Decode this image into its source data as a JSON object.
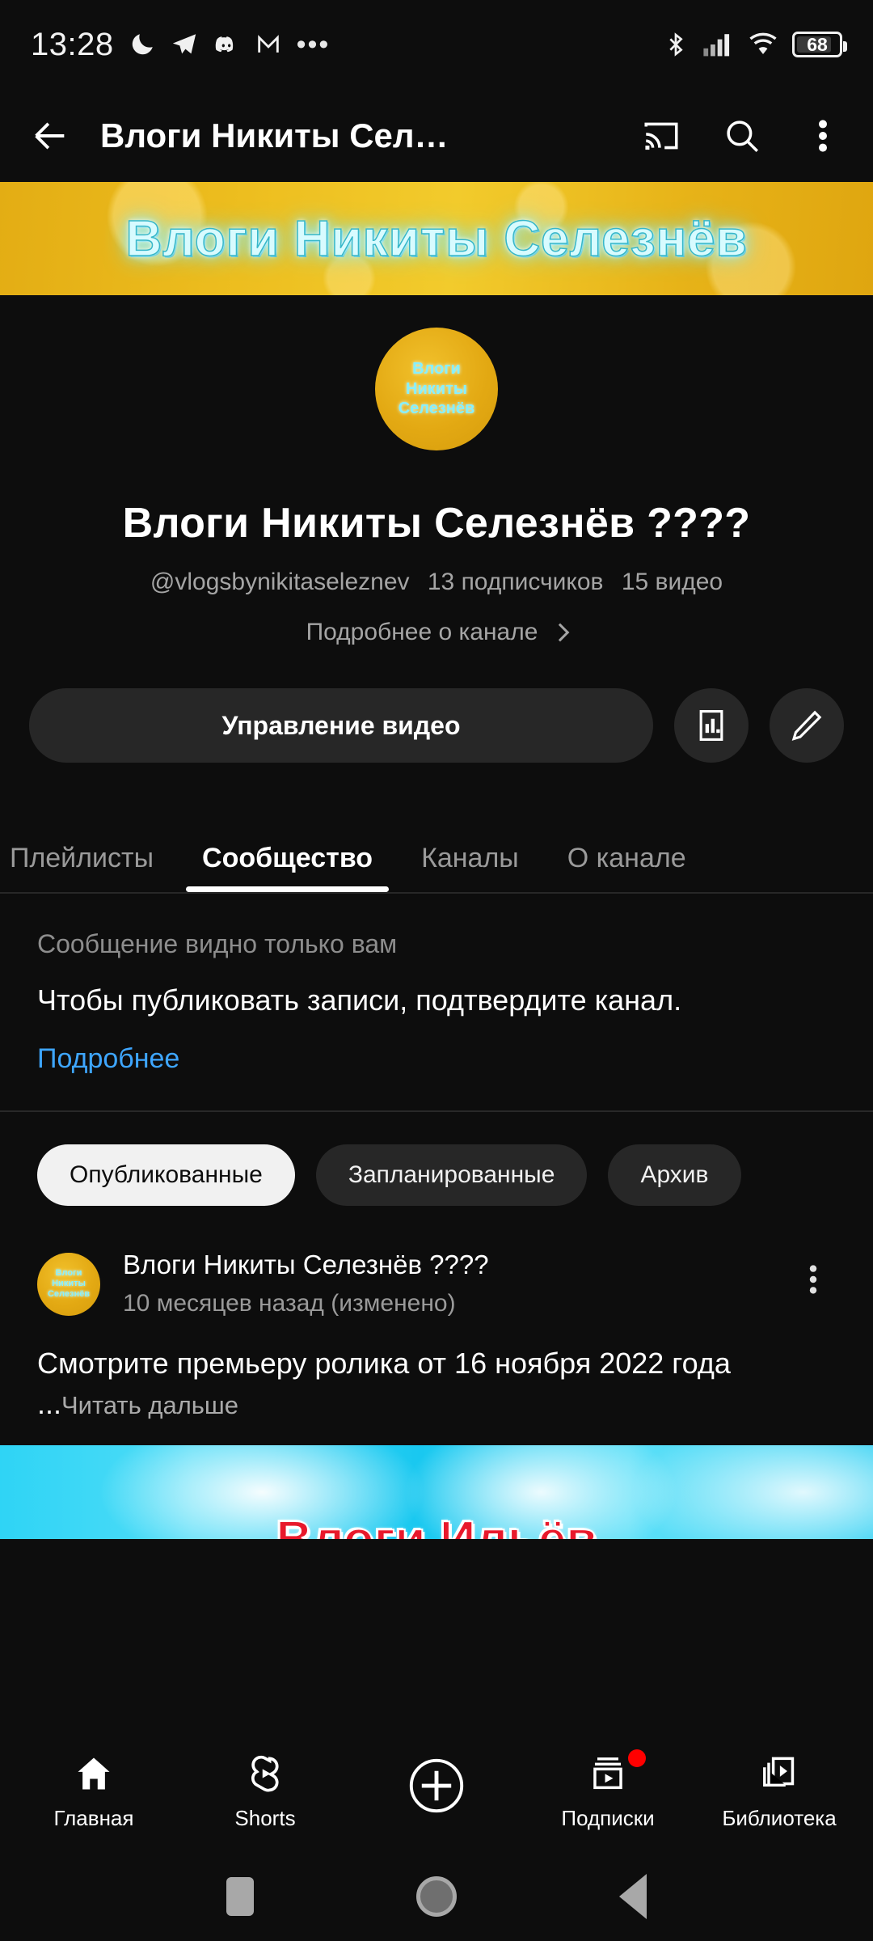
{
  "status_bar": {
    "clock": "13:28",
    "icons_left": [
      "moon-icon",
      "telegram-icon",
      "discord-icon",
      "gmail-icon",
      "more-dots-icon"
    ],
    "more_dots": "•••",
    "icons_right": [
      "bluetooth-icon",
      "signal-icon",
      "wifi-icon"
    ],
    "battery_percent": "68"
  },
  "app_bar": {
    "back_icon": "back-arrow-icon",
    "title": "Влоги Никиты Сел…",
    "cast_icon": "cast-icon",
    "search_icon": "search-icon",
    "overflow_icon": "overflow-menu-icon"
  },
  "banner": {
    "text": "Влоги Никиты Селезнёв",
    "bg_color": "#e8b51a",
    "text_color": "#d8fbff"
  },
  "channel": {
    "avatar_lines": [
      "Влоги",
      "Никиты",
      "Селезнёв"
    ],
    "avatar_color": "#e3a913",
    "title": "Влоги Никиты Селезнёв ????",
    "handle": "@vlogsbynikitaseleznev",
    "subscribers": "13 подписчиков",
    "videos": "15 видео",
    "more_label": "Подробнее о канале"
  },
  "actions": {
    "manage_label": "Управление видео",
    "analytics_icon": "analytics-bar-chart-icon",
    "edit_icon": "pencil-edit-icon"
  },
  "tabs": [
    {
      "label": "Плейлисты",
      "active": false
    },
    {
      "label": "Сообщество",
      "active": true
    },
    {
      "label": "Каналы",
      "active": false
    },
    {
      "label": "О канале",
      "active": false
    }
  ],
  "notice": {
    "visibility": "Сообщение видно только вам",
    "body": "Чтобы публиковать записи, подтвердите канал.",
    "link": "Подробнее",
    "link_color": "#3ea6ff"
  },
  "chips": [
    {
      "label": "Опубликованные",
      "active": true
    },
    {
      "label": "Запланированные",
      "active": false
    },
    {
      "label": "Архив",
      "active": false
    }
  ],
  "post": {
    "avatar_lines": [
      "Влоги",
      "Никиты",
      "Селезнёв"
    ],
    "author": "Влоги Никиты Селезнёв ????",
    "time": "10 месяцев назад (изменено)",
    "menu_icon": "post-overflow-icon",
    "text": "Смотрите премьеру ролика от 16 ноября 2022 года ...",
    "read_more": "Читать дальше",
    "thumbnail_text": "Влоги Ильёв"
  },
  "bottom_nav": [
    {
      "label": "Главная",
      "icon": "home-icon",
      "badge": false
    },
    {
      "label": "Shorts",
      "icon": "shorts-icon",
      "badge": false
    },
    {
      "label": "",
      "icon": "create-plus-icon",
      "badge": false
    },
    {
      "label": "Подписки",
      "icon": "subscriptions-icon",
      "badge": true
    },
    {
      "label": "Библиотека",
      "icon": "library-icon",
      "badge": false
    }
  ],
  "system_nav": {
    "recents_icon": "recents-square-icon",
    "home_icon": "home-circle-icon",
    "back_icon": "back-triangle-icon"
  }
}
